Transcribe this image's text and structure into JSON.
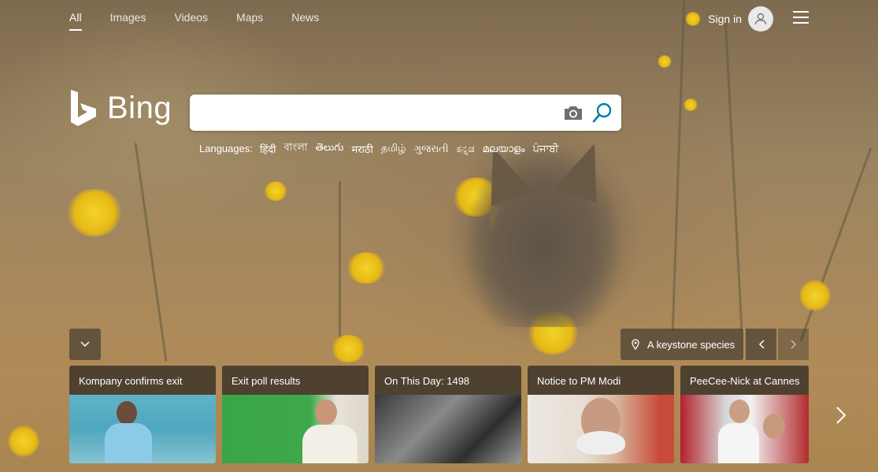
{
  "nav": {
    "items": [
      {
        "label": "All",
        "active": true
      },
      {
        "label": "Images",
        "active": false
      },
      {
        "label": "Videos",
        "active": false
      },
      {
        "label": "Maps",
        "active": false
      },
      {
        "label": "News",
        "active": false
      }
    ]
  },
  "header": {
    "sign_in_label": "Sign in",
    "avatar_icon": "person-icon",
    "menu_icon": "hamburger-menu-icon"
  },
  "logo": {
    "text": "Bing",
    "icon": "bing-b-icon"
  },
  "search": {
    "value": "",
    "placeholder": "",
    "camera_icon": "camera-icon",
    "search_icon": "magnifier-icon",
    "accent_color": "#007daa"
  },
  "languages": {
    "label": "Languages:",
    "items": [
      "हिंदी",
      "বাংলা",
      "తెలుగు",
      "मराठी",
      "தமிழ்",
      "ગુજરાતી",
      "ಕನ್ನಡ",
      "മലയാളം",
      "ਪੰਜਾਬੀ"
    ]
  },
  "image_info": {
    "expand_icon": "chevron-down-icon",
    "location_icon": "map-pin-icon",
    "caption": "A keystone species",
    "prev_icon": "chevron-left-icon",
    "next_icon": "chevron-right-icon"
  },
  "news_cards": [
    {
      "title": "Kompany confirms exit"
    },
    {
      "title": "Exit poll results"
    },
    {
      "title": "On This Day: 1498"
    },
    {
      "title": "Notice to PM Modi"
    },
    {
      "title": "PeeCee-Nick at Cannes"
    }
  ],
  "cards_next_icon": "chevron-right-icon"
}
